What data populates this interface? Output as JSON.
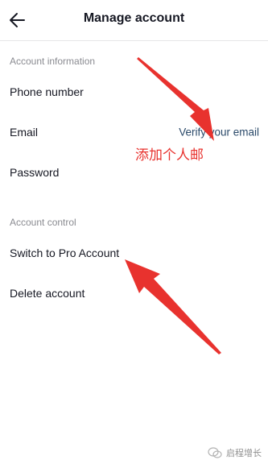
{
  "header": {
    "title": "Manage account",
    "back_icon": "arrow-left-icon"
  },
  "sections": {
    "account_information": {
      "title": "Account information",
      "phone_label": "Phone number",
      "email_label": "Email",
      "email_value": "Verify your email",
      "password_label": "Password"
    },
    "account_control": {
      "title": "Account control",
      "switch_label": "Switch to Pro Account",
      "delete_label": "Delete account"
    }
  },
  "annotation": {
    "text": "添加个人邮",
    "color": "#e8322e"
  },
  "watermark": {
    "text": "启程增长",
    "icon": "wechat-icon"
  },
  "colors": {
    "link": "#2b4a6a",
    "section_header": "#8a8b91",
    "annotation_arrow": "#e8322e"
  }
}
